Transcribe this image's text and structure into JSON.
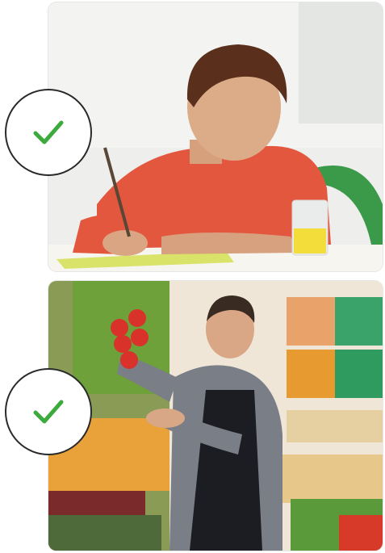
{
  "cards": [
    {
      "image": "boy-writing-at-table-photo",
      "status_icon": "check-icon",
      "status": "correct"
    },
    {
      "image": "grocer-holding-tomatoes-photo",
      "status_icon": "check-icon",
      "status": "correct"
    }
  ],
  "colors": {
    "check": "#3caa3c",
    "badge_border": "#2a2a2a",
    "badge_bg": "#ffffff"
  }
}
